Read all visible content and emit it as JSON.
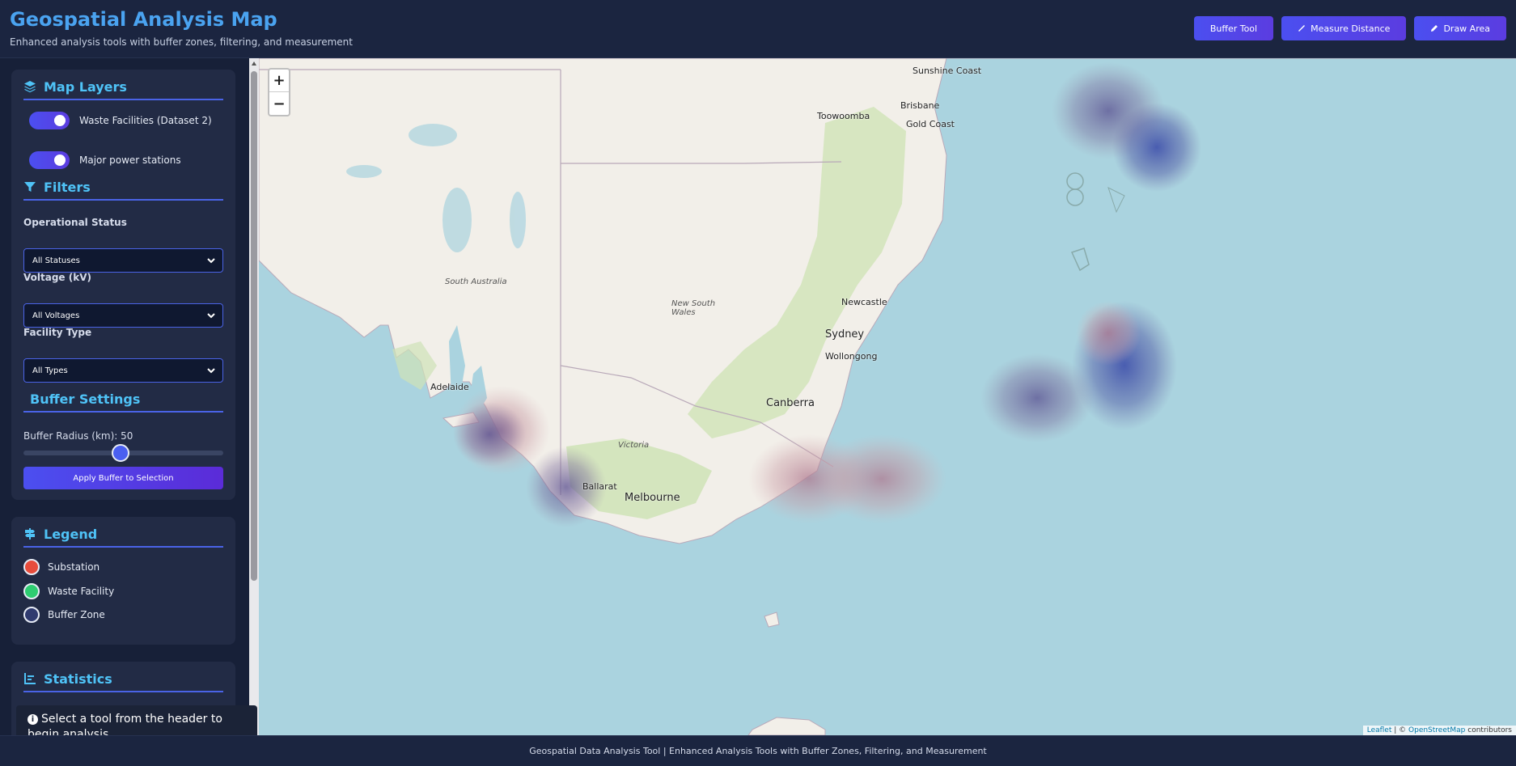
{
  "header": {
    "title": "Geospatial Analysis Map",
    "subtitle": "Enhanced analysis tools with buffer zones, filtering, and measurement",
    "buttons": {
      "buffer": "Buffer Tool",
      "measure": "Measure Distance",
      "draw": "Draw Area"
    }
  },
  "sidebar": {
    "layers": {
      "title": "Map Layers",
      "items": [
        {
          "label": "Waste Facilities (Dataset 2)",
          "enabled": true
        },
        {
          "label": "Major power stations",
          "enabled": true
        }
      ]
    },
    "filters": {
      "title": "Filters",
      "status_label": "Operational Status",
      "status_value": "All Statuses",
      "voltage_label": "Voltage (kV)",
      "voltage_value": "All Voltages",
      "type_label": "Facility Type",
      "type_value": "All Types"
    },
    "buffer": {
      "title": "Buffer Settings",
      "radius_label": "Buffer Radius (km): 50",
      "radius_km": 50,
      "apply_label": "Apply Buffer to Selection"
    },
    "legend": {
      "title": "Legend",
      "items": [
        {
          "label": "Substation",
          "color": "#e74c3c"
        },
        {
          "label": "Waste Facility",
          "color": "#2ecc71"
        },
        {
          "label": "Buffer Zone",
          "color": "#3f4fa0"
        }
      ]
    },
    "statistics": {
      "title": "Statistics"
    }
  },
  "toast": {
    "message": "Select a tool from the header to begin analysis"
  },
  "map": {
    "zoom_in": "+",
    "zoom_out": "−",
    "attribution": {
      "leaflet": "Leaflet",
      "separator": " | © ",
      "osm": "OpenStreetMap",
      "suffix": " contributors"
    },
    "labels": {
      "sunshine_coast": "Sunshine Coast",
      "toowoomba": "Toowoomba",
      "brisbane": "Brisbane",
      "gold_coast": "Gold Coast",
      "newcastle": "Newcastle",
      "sydney": "Sydney",
      "wollongong": "Wollongong",
      "canberra": "Canberra",
      "nsw": "New South Wales",
      "south_australia": "South Australia",
      "adelaide": "Adelaide",
      "victoria": "Victoria",
      "ballarat": "Ballarat",
      "melbourne": "Melbourne"
    },
    "colors": {
      "water": "#aad3df",
      "land": "#f2efe9",
      "vegetation": "#c8dfb0",
      "waste_marker": "#2ecc71",
      "power_marker": "#2e86c1"
    }
  },
  "footer": {
    "text": "Geospatial Data Analysis Tool | Enhanced Analysis Tools with Buffer Zones, Filtering, and Measurement"
  }
}
